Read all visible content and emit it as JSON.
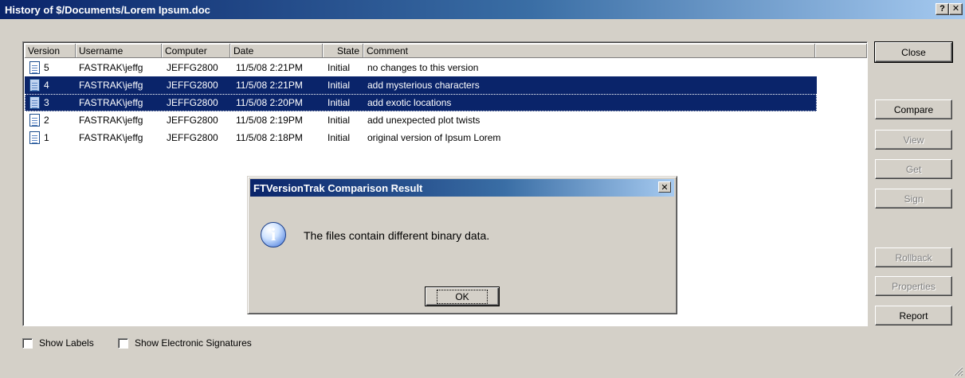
{
  "window": {
    "title": "History of $/Documents/Lorem Ipsum.doc",
    "help_label": "?",
    "close_glyph": "✕"
  },
  "columns": [
    "Version",
    "Username",
    "Computer",
    "Date",
    "State",
    "Comment"
  ],
  "rows": [
    {
      "version": "5",
      "username": "FASTRAK\\jeffg",
      "computer": "JEFFG2800",
      "date": "11/5/08 2:21PM",
      "state": "Initial",
      "comment": "no changes to this version"
    },
    {
      "version": "4",
      "username": "FASTRAK\\jeffg",
      "computer": "JEFFG2800",
      "date": "11/5/08 2:21PM",
      "state": "Initial",
      "comment": "add mysterious characters"
    },
    {
      "version": "3",
      "username": "FASTRAK\\jeffg",
      "computer": "JEFFG2800",
      "date": "11/5/08 2:20PM",
      "state": "Initial",
      "comment": "add exotic locations"
    },
    {
      "version": "2",
      "username": "FASTRAK\\jeffg",
      "computer": "JEFFG2800",
      "date": "11/5/08 2:19PM",
      "state": "Initial",
      "comment": "add unexpected plot twists"
    },
    {
      "version": "1",
      "username": "FASTRAK\\jeffg",
      "computer": "JEFFG2800",
      "date": "11/5/08 2:18PM",
      "state": "Initial",
      "comment": "original version of Ipsum Lorem"
    }
  ],
  "buttons": {
    "close": "Close",
    "compare": "Compare",
    "view": "View",
    "get": "Get",
    "sign": "Sign",
    "rollback": "Rollback",
    "properties": "Properties",
    "report": "Report"
  },
  "checkboxes": {
    "show_labels": "Show Labels",
    "show_signatures": "Show Electronic Signatures"
  },
  "dialog": {
    "title": "FTVersionTrak Comparison Result",
    "message": "The files contain different binary data.",
    "ok": "OK",
    "icon": "information-icon",
    "close_glyph": "✕"
  },
  "colors": {
    "title_active": "#0a246a",
    "selection": "#0a246a",
    "face": "#d4d0c8"
  }
}
